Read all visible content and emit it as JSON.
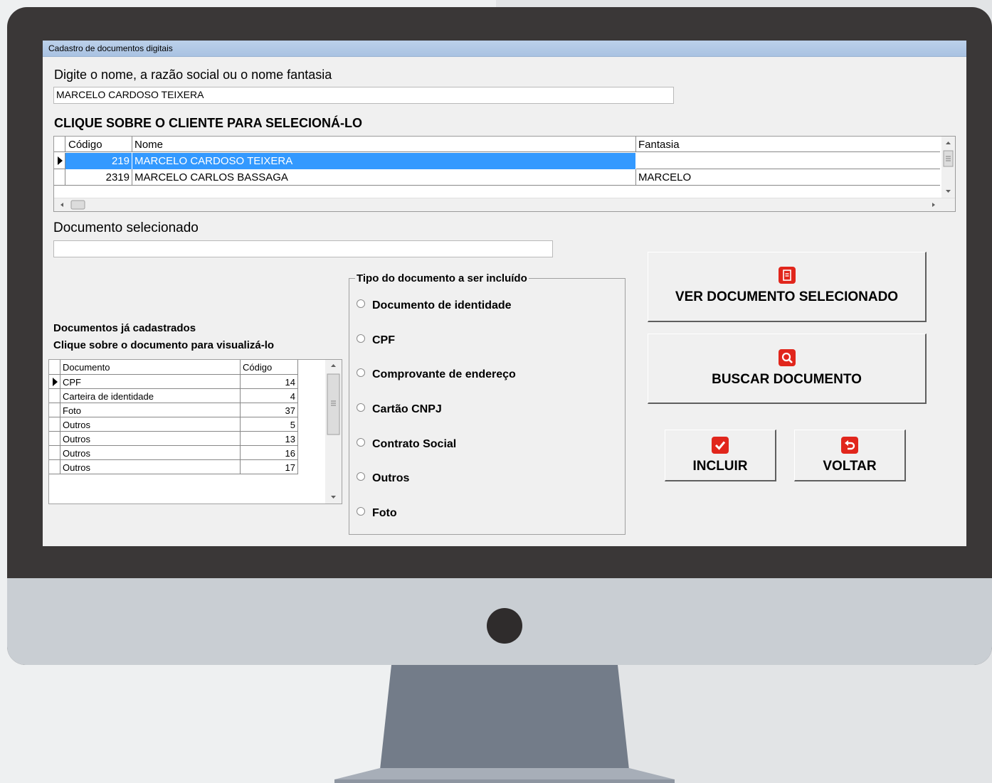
{
  "window": {
    "title": "Cadastro de documentos digitais"
  },
  "search": {
    "label": "Digite o nome, a razão social ou o nome fantasia",
    "value": "MARCELO CARDOSO TEIXERA"
  },
  "client_grid": {
    "heading": "CLIQUE SOBRE O CLIENTE PARA SELECIONÁ-LO",
    "columns": [
      "Código",
      "Nome",
      "Fantasia"
    ],
    "rows": [
      {
        "codigo": "219",
        "nome": "MARCELO CARDOSO TEIXERA",
        "fantasia": ""
      },
      {
        "codigo": "2319",
        "nome": "MARCELO CARLOS BASSAGA",
        "fantasia": "MARCELO"
      }
    ]
  },
  "selected_doc": {
    "label": "Documento selecionado",
    "value": ""
  },
  "doc_list": {
    "title_line1": "Documentos já cadastrados",
    "title_line2": "Clique sobre o documento para visualizá-lo",
    "columns": [
      "Documento",
      "Código"
    ],
    "rows": [
      {
        "documento": "CPF",
        "codigo": "14"
      },
      {
        "documento": "Carteira de identidade",
        "codigo": "4"
      },
      {
        "documento": "Foto",
        "codigo": "37"
      },
      {
        "documento": "Outros",
        "codigo": "5"
      },
      {
        "documento": "Outros",
        "codigo": "13"
      },
      {
        "documento": "Outros",
        "codigo": "16"
      },
      {
        "documento": "Outros",
        "codigo": "17"
      }
    ]
  },
  "doc_type": {
    "legend": "Tipo do documento a ser incluído",
    "options": [
      "Documento de identidade",
      "CPF",
      "Comprovante de endereço",
      "Cartão CNPJ",
      "Contrato Social",
      "Outros",
      "Foto"
    ]
  },
  "buttons": {
    "ver": "VER DOCUMENTO SELECIONADO",
    "buscar": "BUSCAR DOCUMENTO",
    "incluir": "INCLUIR",
    "voltar": "VOLTAR"
  },
  "colors": {
    "selection": "#3399ff",
    "icon_red": "#e1261c",
    "monitor_bezel": "#3a3737",
    "monitor_chin": "#c9ced3",
    "stand": "#737c89"
  }
}
